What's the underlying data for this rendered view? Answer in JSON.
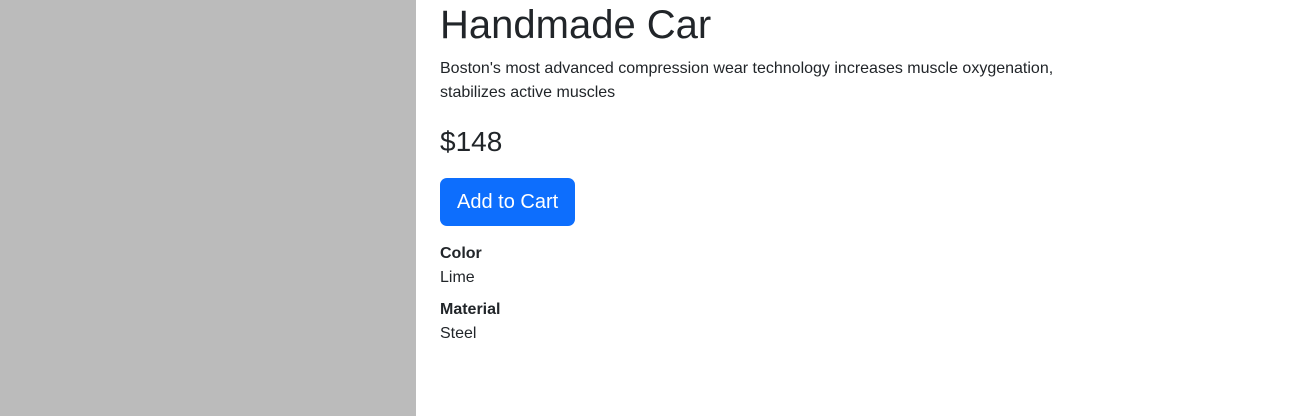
{
  "product": {
    "title": "Handmade Car",
    "description": "Boston's most advanced compression wear technology increases muscle oxygenation, stabilizes active muscles",
    "price": "$148",
    "add_to_cart_label": "Add to Cart",
    "attributes": [
      {
        "label": "Color",
        "value": "Lime"
      },
      {
        "label": "Material",
        "value": "Steel"
      }
    ]
  },
  "colors": {
    "image_placeholder": "#bbbbbb",
    "primary_button": "#0d6efd",
    "text": "#212529"
  }
}
